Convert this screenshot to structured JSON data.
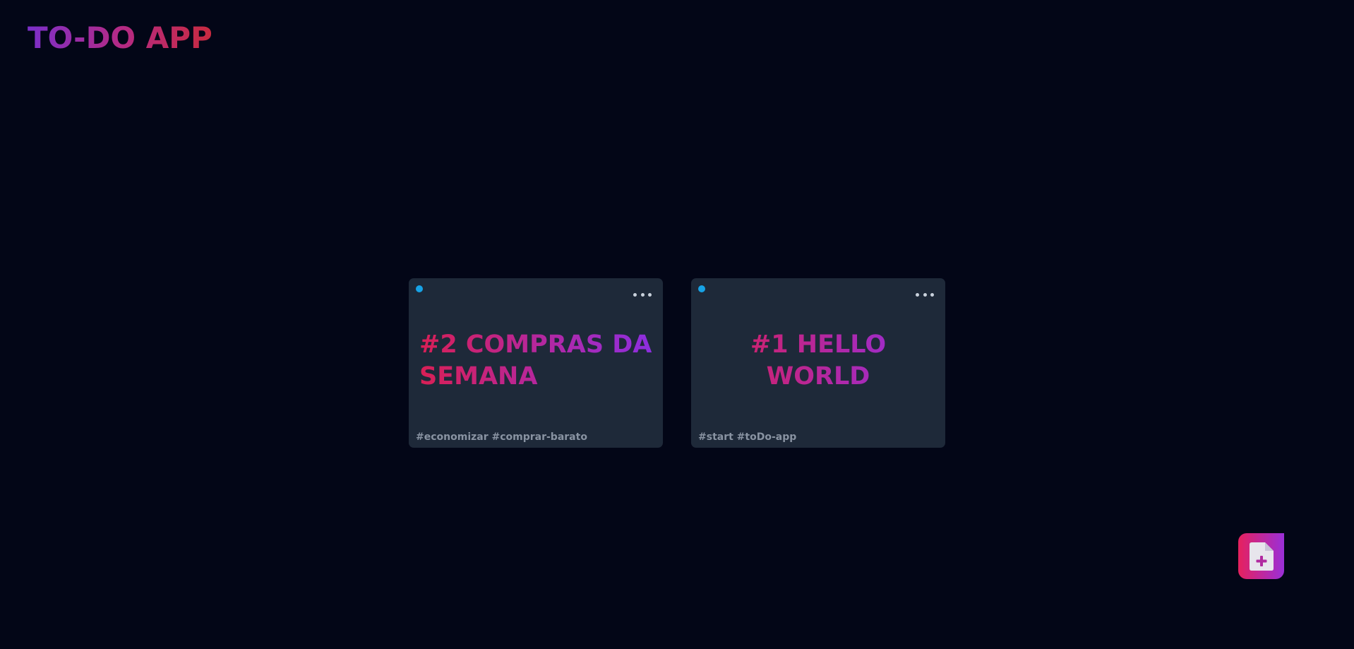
{
  "header": {
    "title": "TO-DO APP"
  },
  "cards": [
    {
      "title": "#2 COMPRAS DA SEMANA",
      "tags": "#economizar #comprar-barato",
      "status_color": "#17a2e6",
      "menu_icon": "more-horizontal-icon"
    },
    {
      "title": "#1 HELLO WORLD",
      "tags": "#start #toDo-app",
      "status_color": "#17a2e6",
      "menu_icon": "more-horizontal-icon"
    }
  ],
  "fab": {
    "icon": "file-plus-icon"
  },
  "colors": {
    "background": "#030617",
    "card": "#1e2939",
    "accent_pink": "#e6215e",
    "accent_purple": "#9a2fd8",
    "status_blue": "#17a2e6",
    "tag_text": "#8993a2"
  }
}
